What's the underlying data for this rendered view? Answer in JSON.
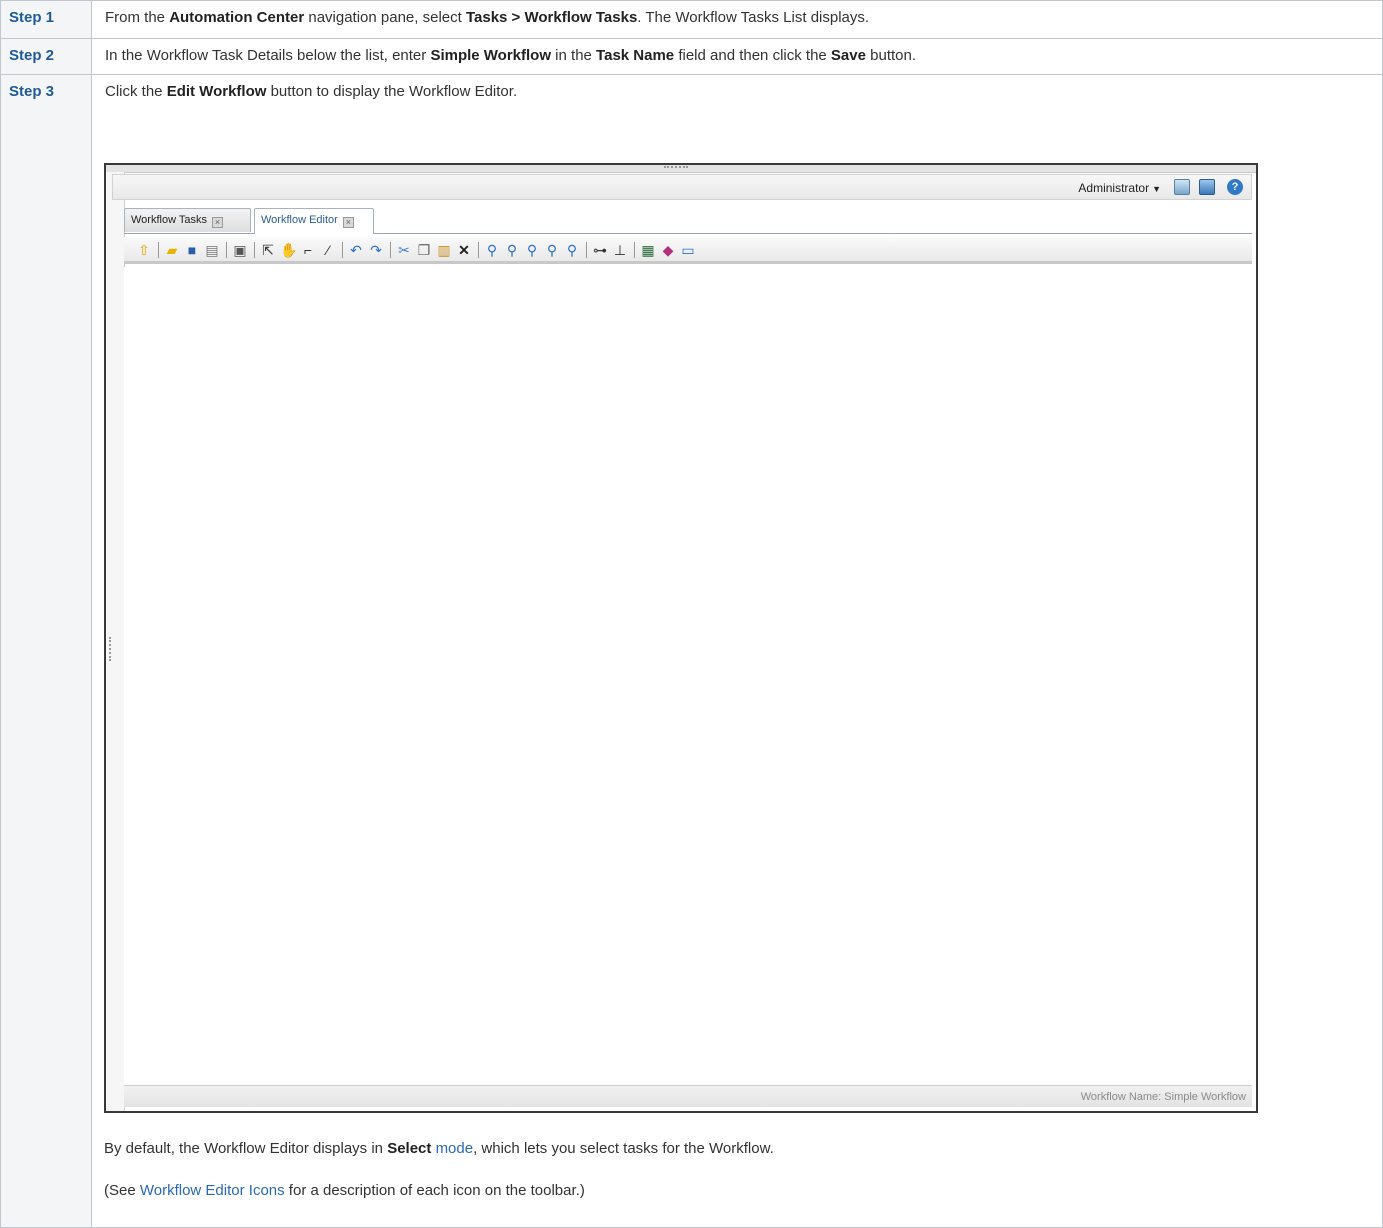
{
  "steps": [
    {
      "label": "Step 1",
      "pre": "From the ",
      "b1": "Automation Center",
      "mid1": " navigation pane, select ",
      "b2": "Tasks > Workflow Tasks",
      "post": ". The Workflow Tasks List displays."
    },
    {
      "label": "Step 2",
      "pre": "In the Workflow Task Details below the list, enter ",
      "b1": "Simple Workflow",
      "mid1": " in the ",
      "b2": "Task Name",
      "mid2": " field and then click the ",
      "b3": "Save",
      "post": " button."
    },
    {
      "label": "Step 3",
      "pre": "Click the ",
      "b1": "Edit Workflow",
      "post": " button to display the Workflow Editor."
    }
  ],
  "screenshot": {
    "user_menu": "Administrator",
    "tabs": [
      "Workflow Tasks",
      "Workflow Editor"
    ],
    "active_tab": "Workflow Editor",
    "status_text": "Workflow Name: Simple Workflow",
    "toolbar_icons": [
      "up-arrow-icon",
      "open-folder-icon",
      "save-icon",
      "print-icon",
      "print-preview-icon",
      "select-pointer-icon",
      "pan-hand-icon",
      "connector-elbow-icon",
      "connector-straight-icon",
      "undo-icon",
      "redo-icon",
      "cut-icon",
      "copy-icon",
      "paste-icon",
      "delete-icon",
      "zoom-icon",
      "zoom-in-icon",
      "zoom-out-icon",
      "zoom-fit-icon",
      "zoom-actual-icon",
      "layout-horizontal-icon",
      "layout-tree-icon",
      "properties-icon",
      "book-icon",
      "monitor-icon"
    ]
  },
  "after": {
    "p1_pre": "By default, the Workflow Editor displays in ",
    "p1_bold": "Select",
    "p1_link": "mode",
    "p1_post": ", which lets you select tasks for the Workflow.",
    "p2_pre": "(See ",
    "p2_link": "Workflow Editor Icons",
    "p2_post": " for a description of each icon on the toolbar.)"
  }
}
